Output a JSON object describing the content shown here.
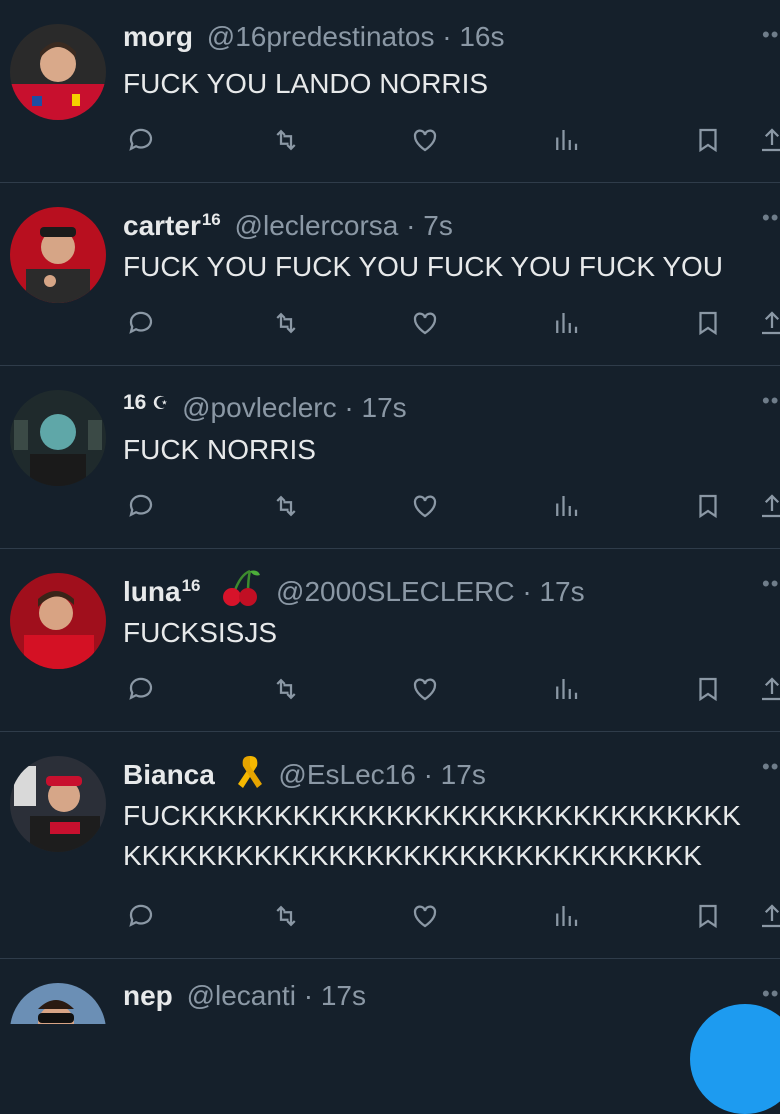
{
  "tweets": [
    {
      "name": "morg",
      "sup": "",
      "handle": "@16predestinatos",
      "sep": "·",
      "time": "16s",
      "text": "FUCK YOU LANDO NORRIS",
      "icon": "none"
    },
    {
      "name": "carter",
      "sup": "16",
      "handle": "@leclercorsa",
      "sep": "·",
      "time": "7s",
      "text": "FUCK YOU FUCK YOU FUCK YOU FUCK YOU",
      "icon": "none"
    },
    {
      "name": "16",
      "sup": "",
      "handle": "@povleclerc",
      "sep": "·",
      "time": "17s",
      "text": "FUCK NORRIS",
      "icon": "crescent"
    },
    {
      "name": "luna",
      "sup": "16",
      "handle": "@2000SLECLERC",
      "sep": "·",
      "time": "17s",
      "text": "FUCKSISJS",
      "icon": "cherries-icon"
    },
    {
      "name": "Bianca",
      "sup": "",
      "handle": "@EsLec16",
      "sep": "·",
      "time": "17s",
      "text": "FUCKKKKKKKKKKKKKKKKKKKKKKKKKKKKKK",
      "text2": "KKKKKKKKKKKKKKKKKKKKKKKKKKKKKKK",
      "icon": "ribbon-icon"
    },
    {
      "name": "nep",
      "sup": "",
      "handle": "@lecanti",
      "sep": "·",
      "time": "17s",
      "text": "",
      "icon": "none"
    }
  ],
  "crescent_glyph": "☪",
  "colors": {
    "bg": "#15202b",
    "text": "#e7e9ea",
    "muted": "#8b98a5",
    "icon": "#8b98a5",
    "accent": "#1d9bf0"
  },
  "action_icons": [
    "reply-icon",
    "retweet-icon",
    "like-icon",
    "views-icon",
    "bookmark-icon",
    "share-icon"
  ]
}
